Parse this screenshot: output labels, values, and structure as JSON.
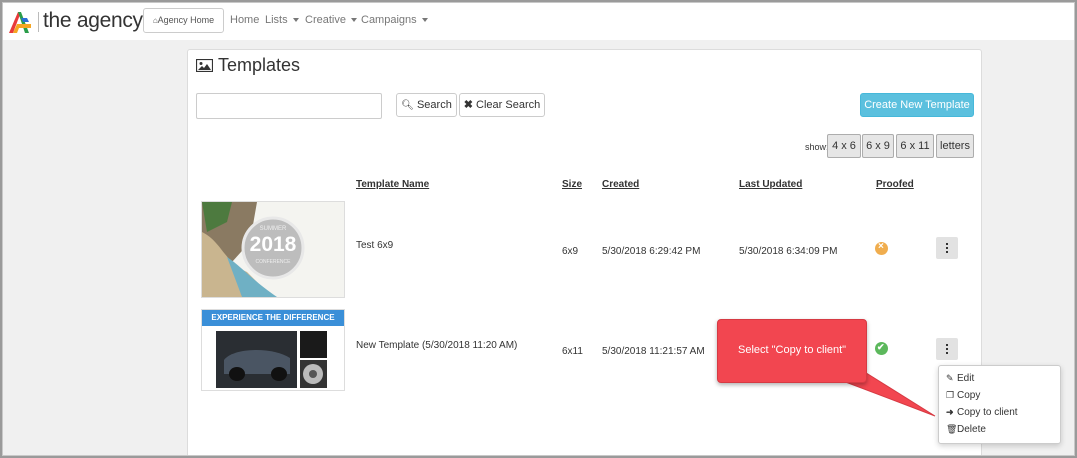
{
  "brand": {
    "name": "the agency"
  },
  "nav": {
    "home_label": "Agency Home",
    "home_icon": "home-icon",
    "items": [
      {
        "label": "Home",
        "dropdown": false
      },
      {
        "label": "Lists",
        "dropdown": true
      },
      {
        "label": "Creative",
        "dropdown": true
      },
      {
        "label": "Campaigns",
        "dropdown": true
      }
    ]
  },
  "page": {
    "title": "Templates",
    "title_icon": "image-icon",
    "search": {
      "value": "",
      "placeholder": ""
    },
    "search_button": "Search",
    "clear_button": "Clear Search",
    "create_button": "Create New Template",
    "show_label": "show:",
    "size_filters": [
      "4 x 6",
      "6 x 9",
      "6 x 11",
      "letters"
    ]
  },
  "table": {
    "headers": {
      "name": "Template Name",
      "size": "Size",
      "created": "Created",
      "updated": "Last Updated",
      "proofed": "Proofed"
    },
    "rows": [
      {
        "name": "Test 6x9",
        "size": "6x9",
        "created": "5/30/2018 6:29:42 PM",
        "updated": "5/30/2018 6:34:09 PM",
        "proofed": "no",
        "thumb": {
          "year": "2018",
          "top": "SUMMER",
          "bottom": "CONFERENCE"
        }
      },
      {
        "name": "New Template (5/30/2018 11:20 AM)",
        "size": "6x11",
        "created": "5/30/2018 11:21:57 AM",
        "updated": "",
        "proofed": "yes",
        "thumb": {
          "banner": "EXPERIENCE THE DIFFERENCE"
        }
      }
    ]
  },
  "actions_menu": {
    "items": [
      {
        "label": "Edit",
        "icon": "edit-icon"
      },
      {
        "label": "Copy",
        "icon": "copy-icon"
      },
      {
        "label": "Copy to client",
        "icon": "arrow-right-icon"
      },
      {
        "label": "Delete",
        "icon": "trash-icon"
      }
    ]
  },
  "callout": {
    "text": "Select \"Copy to client\""
  },
  "colors": {
    "primary": "#5bc0de",
    "proofed_no": "#f0ad4e",
    "proofed_yes": "#5cb85c",
    "callout": "#f24650",
    "banner": "#3a8fd8"
  }
}
